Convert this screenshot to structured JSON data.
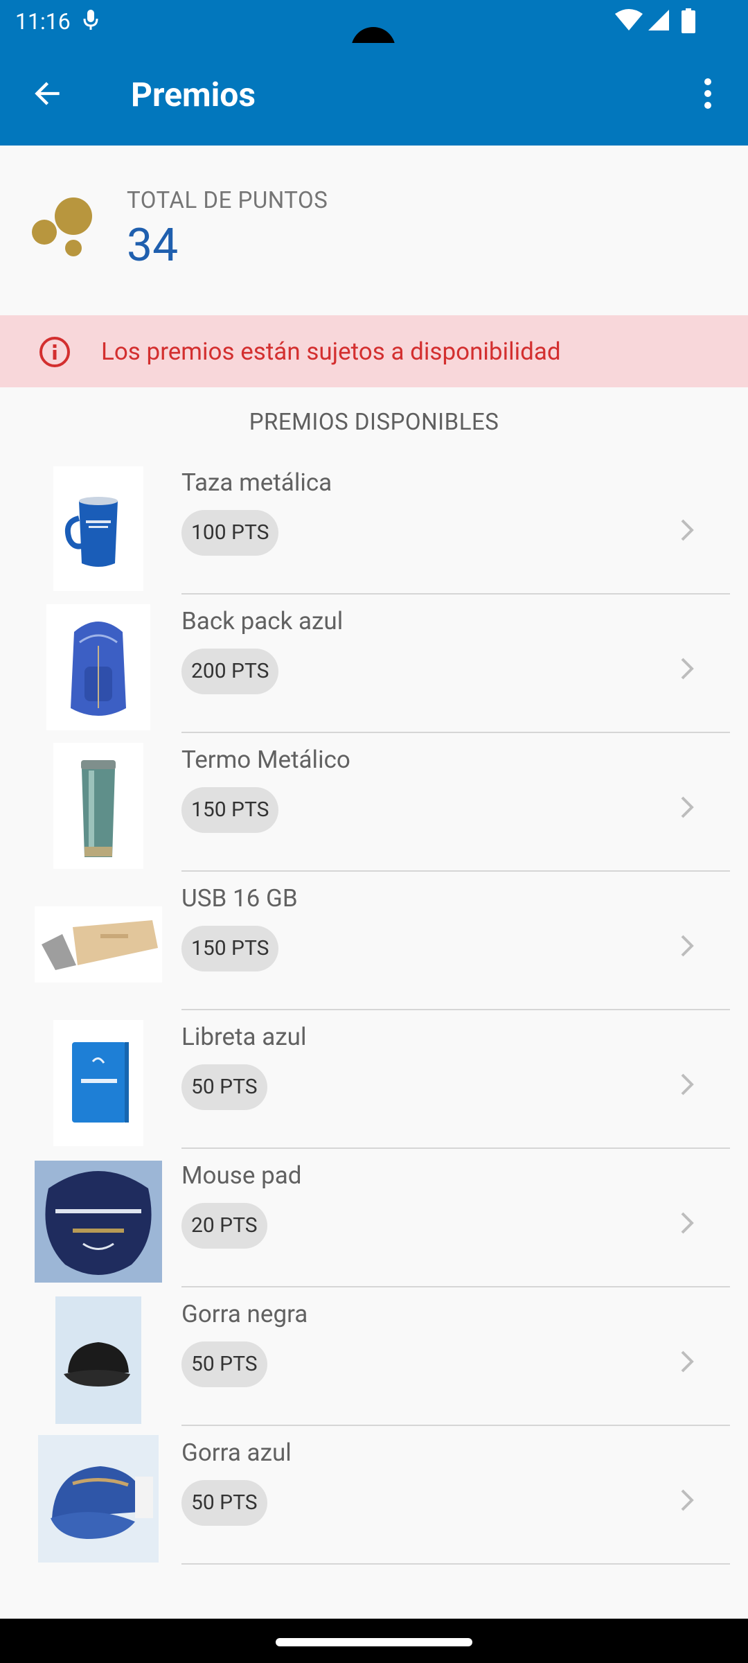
{
  "status": {
    "time": "11:16"
  },
  "appbar": {
    "title": "Premios"
  },
  "points": {
    "label": "TOTAL DE PUNTOS",
    "value": "34"
  },
  "alert": {
    "text": "Los premios están sujetos a disponibilidad"
  },
  "section": {
    "title": "PREMIOS DISPONIBLES"
  },
  "rewards": [
    {
      "name": "Taza metálica",
      "points": "100 PTS",
      "image": "mug"
    },
    {
      "name": "Back pack azul",
      "points": "200 PTS",
      "image": "backpack"
    },
    {
      "name": "Termo Metálico",
      "points": "150 PTS",
      "image": "thermos"
    },
    {
      "name": "USB 16 GB",
      "points": "150 PTS",
      "image": "usb"
    },
    {
      "name": "Libreta azul",
      "points": "50 PTS",
      "image": "notebook"
    },
    {
      "name": "Mouse pad",
      "points": "20 PTS",
      "image": "mousepad"
    },
    {
      "name": "Gorra negra",
      "points": "50 PTS",
      "image": "black-cap"
    },
    {
      "name": "Gorra azul",
      "points": "50 PTS",
      "image": "blue-cap"
    }
  ],
  "colors": {
    "primary": "#0277bd",
    "points_value": "#1f5fae",
    "alert_bg": "#f8d7da",
    "alert_text": "#d32f2f",
    "coin": "#b8963e"
  }
}
